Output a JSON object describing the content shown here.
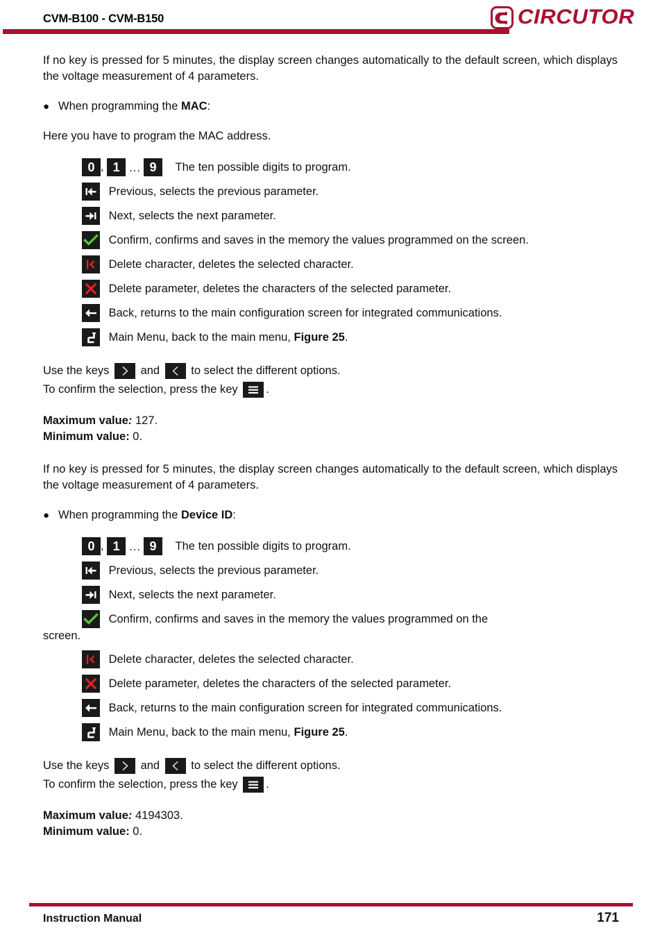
{
  "header": {
    "title": "CVM-B100 - CVM-B150",
    "logo_text": "CIRCUTOR",
    "accent_color": "#A81132"
  },
  "sections": [
    {
      "intro": "If no key is pressed for 5 minutes, the display screen changes automatically to the default screen, which displays the voltage measurement of 4 parameters.",
      "bullet_prefix": "When programming the ",
      "bullet_bold": "MAC",
      "bullet_suffix": ":",
      "lead": "Here you have to program the MAC address.",
      "digits": {
        "first": "0",
        "comma": ",",
        "second": "1",
        "ellipsis": "...",
        "last": "9",
        "label": "The ten possible digits to program."
      },
      "keys": [
        {
          "icon": "previous-icon",
          "label": "Previous, selects the previous parameter."
        },
        {
          "icon": "next-icon",
          "label": "Next, selects the next parameter."
        },
        {
          "icon": "confirm-icon",
          "label": "Confirm, confirms and saves in the memory the values programmed on the screen."
        },
        {
          "icon": "delete-character-icon",
          "label": "Delete character, deletes the selected character."
        },
        {
          "icon": "delete-parameter-icon",
          "label": "Delete parameter, deletes the characters of the selected parameter."
        },
        {
          "icon": "back-icon",
          "label": "Back, returns to the main configuration screen for integrated communications."
        },
        {
          "icon": "main-menu-icon",
          "label_prefix": "Main Menu, back to the main menu, ",
          "label_bold": "Figure 25",
          "label_suffix": "."
        }
      ],
      "keys_sentence": {
        "part1": "Use the keys",
        "part2": "and",
        "part3": "to select the different options.",
        "part4": "To confirm the selection, press the key",
        "part5": "."
      },
      "values": {
        "max_label": "Maximum value",
        "max_colon": ":",
        "max_value": " 127.",
        "min_label": "Minimum value:",
        "min_value": " 0."
      }
    },
    {
      "intro": "If no key is pressed for 5 minutes, the display screen changes automatically to the default screen, which displays the voltage measurement of 4 parameters.",
      "bullet_prefix": "When programming the ",
      "bullet_bold": "Device ID",
      "bullet_suffix": ":",
      "digits": {
        "first": "0",
        "comma": ",",
        "second": "1",
        "ellipsis": "...",
        "last": "9",
        "label": "The ten possible digits to program."
      },
      "keys": [
        {
          "icon": "previous-icon",
          "label": "Previous, selects the previous parameter."
        },
        {
          "icon": "next-icon",
          "label": "Next, selects the next parameter."
        },
        {
          "icon": "confirm-icon",
          "label": "Confirm, confirms and saves in the memory the values programmed on the",
          "label_wrap": "screen."
        },
        {
          "icon": "delete-character-icon",
          "label": "Delete character, deletes the selected character."
        },
        {
          "icon": "delete-parameter-icon",
          "label": "Delete parameter, deletes the characters of the selected parameter."
        },
        {
          "icon": "back-icon",
          "label": "Back, returns to the main configuration screen for integrated communications."
        },
        {
          "icon": "main-menu-icon",
          "label_prefix": "Main Menu, back to the main menu, ",
          "label_bold": "Figure 25",
          "label_suffix": "."
        }
      ],
      "keys_sentence": {
        "part1": "Use the keys",
        "part2": "and",
        "part3": "to select the different options.",
        "part4": "To confirm the selection, press the key",
        "part5": "."
      },
      "values": {
        "max_label": "Maximum value",
        "max_colon": ":",
        "max_value": " 4194303.",
        "min_label": "Minimum value:",
        "min_value": " 0."
      }
    }
  ],
  "footer": {
    "left": "Instruction Manual",
    "page": "171"
  }
}
